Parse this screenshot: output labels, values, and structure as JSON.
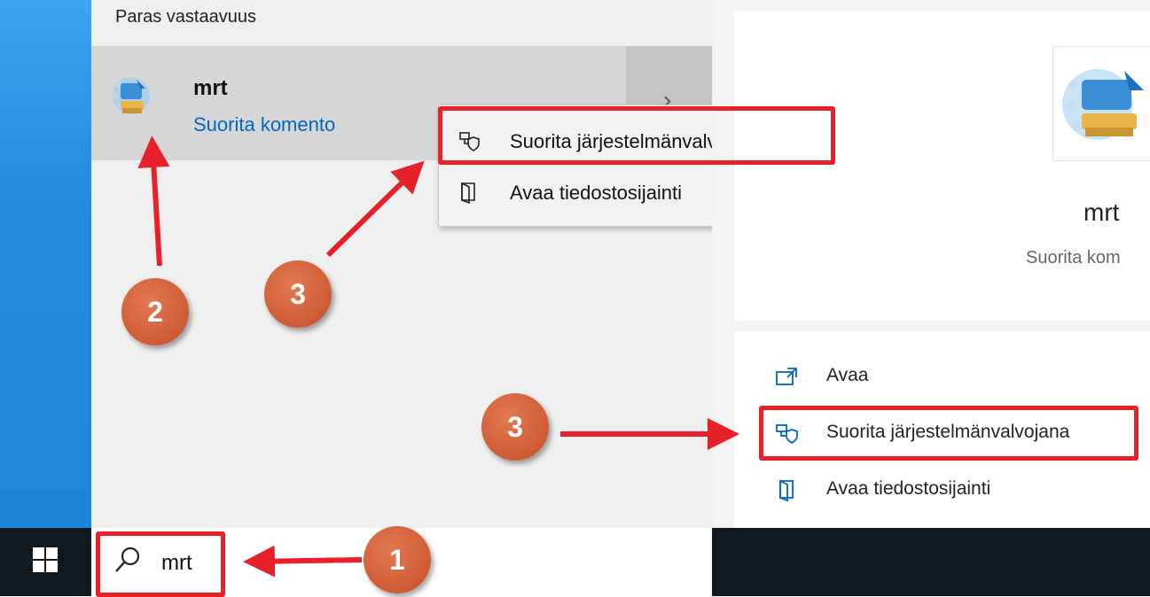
{
  "search_panel": {
    "best_match_header": "Paras vastaavuus",
    "best_match": {
      "name": "mrt",
      "type": "Suorita komento",
      "icon": "mrt-app-icon"
    },
    "expand_icon": "chevron-right-icon",
    "context_menu": [
      {
        "label": "Suorita järjestelmänvalvojana",
        "icon": "run-as-admin-icon"
      },
      {
        "label": "Avaa tiedostosijainti",
        "icon": "open-file-location-icon"
      }
    ]
  },
  "preview": {
    "name": "mrt",
    "type": "Suorita kom",
    "actions": [
      {
        "label": "Avaa",
        "icon": "open-icon"
      },
      {
        "label": "Suorita järjestelmänvalvojana",
        "icon": "run-as-admin-icon"
      },
      {
        "label": "Avaa tiedostosijainti",
        "icon": "open-file-location-icon"
      }
    ]
  },
  "taskbar": {
    "start_icon": "windows-logo-icon",
    "search_icon": "search-icon",
    "search_value": "mrt"
  },
  "annotations": {
    "badges": [
      "1",
      "2",
      "3",
      "3"
    ],
    "colors": {
      "highlight": "#e8202a",
      "badge": "#cf5b35"
    }
  }
}
